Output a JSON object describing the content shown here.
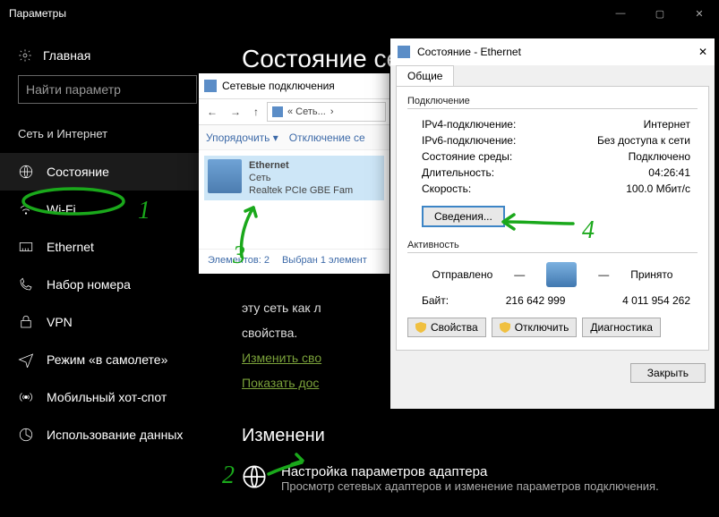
{
  "settings": {
    "window_title": "Параметры",
    "home": "Главная",
    "search_placeholder": "Найти параметр",
    "group": "Сеть и Интернет",
    "nav": [
      {
        "label": "Состояние"
      },
      {
        "label": "Wi-Fi"
      },
      {
        "label": "Ethernet"
      },
      {
        "label": "Набор номера"
      },
      {
        "label": "VPN"
      },
      {
        "label": "Режим «в самолете»"
      },
      {
        "label": "Мобильный хот-спот"
      },
      {
        "label": "Использование данных"
      }
    ],
    "page": {
      "heading_partial": "Сост",
      "body_partial_1": "эту сеть как лимитное подключение или измените другие свойства.",
      "body_prop": "свойства.",
      "link1_partial": "Изменить свойства подключения",
      "link2_partial": "Показать доступные сети",
      "subhead_partial": "Изменение сетевых параметров",
      "adapter_title": "Настройка параметров адаптера",
      "adapter_sub": "Просмотр сетевых адаптеров и изменение параметров подключения."
    }
  },
  "nc": {
    "title": "Сетевые подключения",
    "addr_crumbs": [
      "« Сеть...",
      "›"
    ],
    "toolbar_sort": "Упорядочить ▾",
    "toolbar_disable": "Отключение сетевого устройства",
    "item": {
      "name": "Ethernet",
      "net": "Сеть",
      "dev": "Realtek PCIe GBE Family Controller"
    },
    "status_count": "Элементов: 2",
    "status_sel": "Выбран 1 элемент"
  },
  "st": {
    "title": "Состояние - Ethernet",
    "tab": "Общие",
    "conn_group": "Подключение",
    "rows": [
      {
        "k": "IPv4-подключение:",
        "v": "Интернет"
      },
      {
        "k": "IPv6-подключение:",
        "v": "Без доступа к сети"
      },
      {
        "k": "Состояние среды:",
        "v": "Подключено"
      },
      {
        "k": "Длительность:",
        "v": "04:26:41"
      },
      {
        "k": "Скорость:",
        "v": "100.0 Мбит/с"
      }
    ],
    "details_btn": "Сведения...",
    "activity_group": "Активность",
    "sent": "Отправлено",
    "recv": "Принято",
    "bytes_label": "Байт:",
    "bytes_sent": "216 642 999",
    "bytes_recv": "4 011 954 262",
    "btn_props": "Свойства",
    "btn_disable": "Отключить",
    "btn_diag": "Диагностика",
    "close": "Закрыть"
  },
  "annotations": {
    "n1": "1",
    "n2": "2",
    "n3": "3",
    "n4": "4"
  }
}
